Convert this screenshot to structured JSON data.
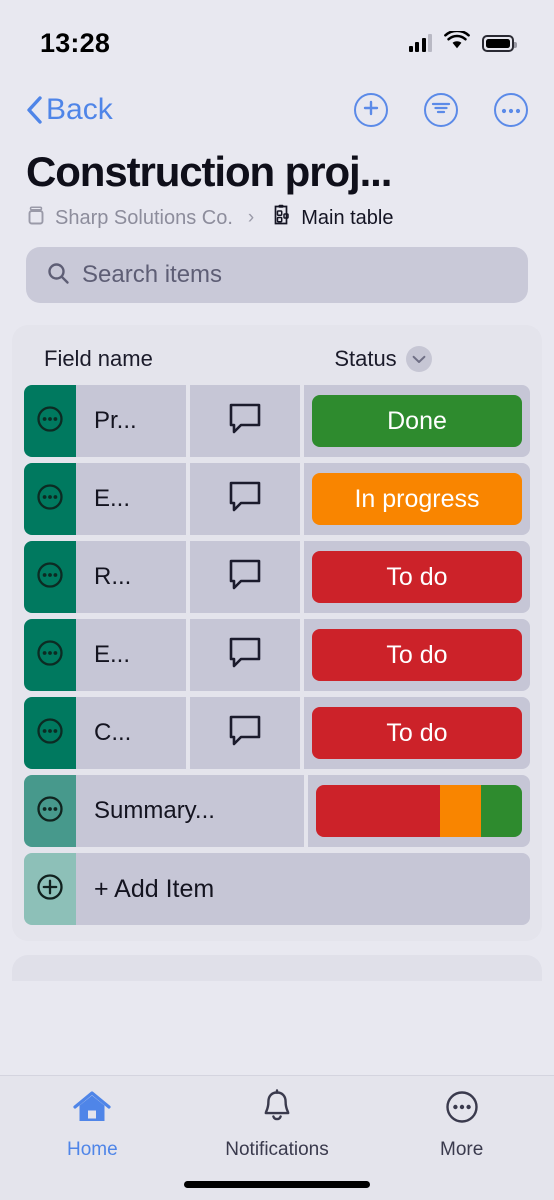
{
  "status_bar": {
    "time": "13:28",
    "signal_icon": "cellular-signal-icon",
    "wifi_icon": "wifi-icon",
    "battery_icon": "battery-icon"
  },
  "nav": {
    "back_label": "Back",
    "back_icon": "chevron-left-icon",
    "actions": [
      {
        "name": "add-button",
        "icon": "plus-circle-icon"
      },
      {
        "name": "filter-button",
        "icon": "filter-lines-circle-icon"
      },
      {
        "name": "more-button",
        "icon": "ellipsis-circle-icon"
      }
    ]
  },
  "header": {
    "title": "Construction proj...",
    "breadcrumb": {
      "org_icon": "box-icon",
      "org": "Sharp Solutions Co.",
      "separator": "›",
      "table_icon": "clipboard-board-icon",
      "table": "Main table"
    }
  },
  "search": {
    "placeholder": "Search items",
    "icon": "search-icon"
  },
  "table": {
    "columns": {
      "field_name": "Field name",
      "status": "Status",
      "status_chevron_icon": "chevron-down-icon"
    },
    "rows": [
      {
        "name": "Pr...",
        "note_icon": "comment-icon",
        "status": "Done",
        "status_class": "done"
      },
      {
        "name": "E...",
        "note_icon": "comment-icon",
        "status": "In progress",
        "status_class": "progress"
      },
      {
        "name": "R...",
        "note_icon": "comment-icon",
        "status": "To do",
        "status_class": "todo"
      },
      {
        "name": "E...",
        "note_icon": "comment-icon",
        "status": "To do",
        "status_class": "todo"
      },
      {
        "name": "C...",
        "note_icon": "comment-icon",
        "status": "To do",
        "status_class": "todo"
      }
    ],
    "summary_row": {
      "name": "Summary...",
      "menu_icon": "ellipsis-circle-icon",
      "segments": [
        {
          "label": "To do",
          "color": "#cc2229",
          "percent": 60
        },
        {
          "label": "In progress",
          "color": "#f98500",
          "percent": 20
        },
        {
          "label": "Done",
          "color": "#2e8b2e",
          "percent": 20
        }
      ]
    },
    "add_row": {
      "label": "+ Add Item",
      "icon": "plus-circle-icon"
    },
    "row_menu_icon": "ellipsis-circle-icon"
  },
  "tab_bar": {
    "tabs": [
      {
        "label": "Home",
        "icon": "home-icon",
        "active": true
      },
      {
        "label": "Notifications",
        "icon": "bell-icon",
        "active": false
      },
      {
        "label": "More",
        "icon": "ellipsis-circle-icon",
        "active": false
      }
    ]
  },
  "colors": {
    "accent_blue": "#4f85e8",
    "row_accent_green": "#00795f",
    "summary_accent_green": "#47998c",
    "add_accent_green": "#8dc0b8",
    "status_done": "#2e8b2e",
    "status_progress": "#f98500",
    "status_todo": "#cc2229",
    "page_background": "#e8e8f0",
    "cell_background": "#c6c6d6"
  }
}
